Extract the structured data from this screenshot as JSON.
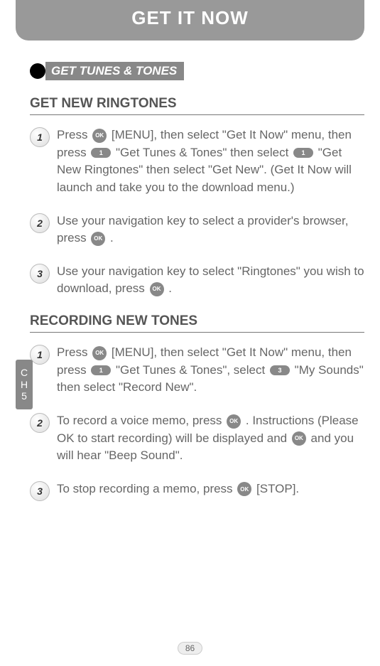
{
  "header": {
    "title": "GET IT NOW"
  },
  "subheader": {
    "label": "GET TUNES & TONES"
  },
  "sidetab": {
    "line1": "C",
    "line2": "H",
    "line3": "5"
  },
  "page_number": "86",
  "keys": {
    "ok": "OK",
    "one": "1",
    "three": "3"
  },
  "sections": [
    {
      "title": "GET NEW RINGTONES",
      "steps": [
        {
          "num": "1",
          "parts": [
            {
              "t": "Press "
            },
            {
              "key": "ok"
            },
            {
              "t": " [MENU], then select \"Get It Now\" menu, then press "
            },
            {
              "key": "one"
            },
            {
              "t": " \"Get Tunes & Tones\" then select "
            },
            {
              "key": "one"
            },
            {
              "t": " \"Get New Ringtones\" then select \"Get New\". (Get It Now will launch and take you to the download menu.)"
            }
          ]
        },
        {
          "num": "2",
          "parts": [
            {
              "t": "Use your navigation key to select a provider's browser, press "
            },
            {
              "key": "ok"
            },
            {
              "t": " ."
            }
          ]
        },
        {
          "num": "3",
          "parts": [
            {
              "t": "Use your navigation key to select \"Ringtones\" you wish to download, press "
            },
            {
              "key": "ok"
            },
            {
              "t": " ."
            }
          ]
        }
      ]
    },
    {
      "title": "RECORDING NEW TONES",
      "steps": [
        {
          "num": "1",
          "parts": [
            {
              "t": "Press "
            },
            {
              "key": "ok"
            },
            {
              "t": " [MENU], then select \"Get It Now\" menu, then press "
            },
            {
              "key": "one"
            },
            {
              "t": " \"Get Tunes & Tones\", select "
            },
            {
              "key": "three"
            },
            {
              "t": " \"My Sounds\" then select \"Record New\"."
            }
          ]
        },
        {
          "num": "2",
          "parts": [
            {
              "t": "To record a voice memo, press "
            },
            {
              "key": "ok"
            },
            {
              "t": " . Instructions (Please OK to start recording) will be displayed and "
            },
            {
              "key": "ok"
            },
            {
              "t": " and you will hear \"Beep Sound\"."
            }
          ]
        },
        {
          "num": "3",
          "parts": [
            {
              "t": "To stop recording a memo, press "
            },
            {
              "key": "ok"
            },
            {
              "t": " [STOP]."
            }
          ]
        }
      ]
    }
  ]
}
